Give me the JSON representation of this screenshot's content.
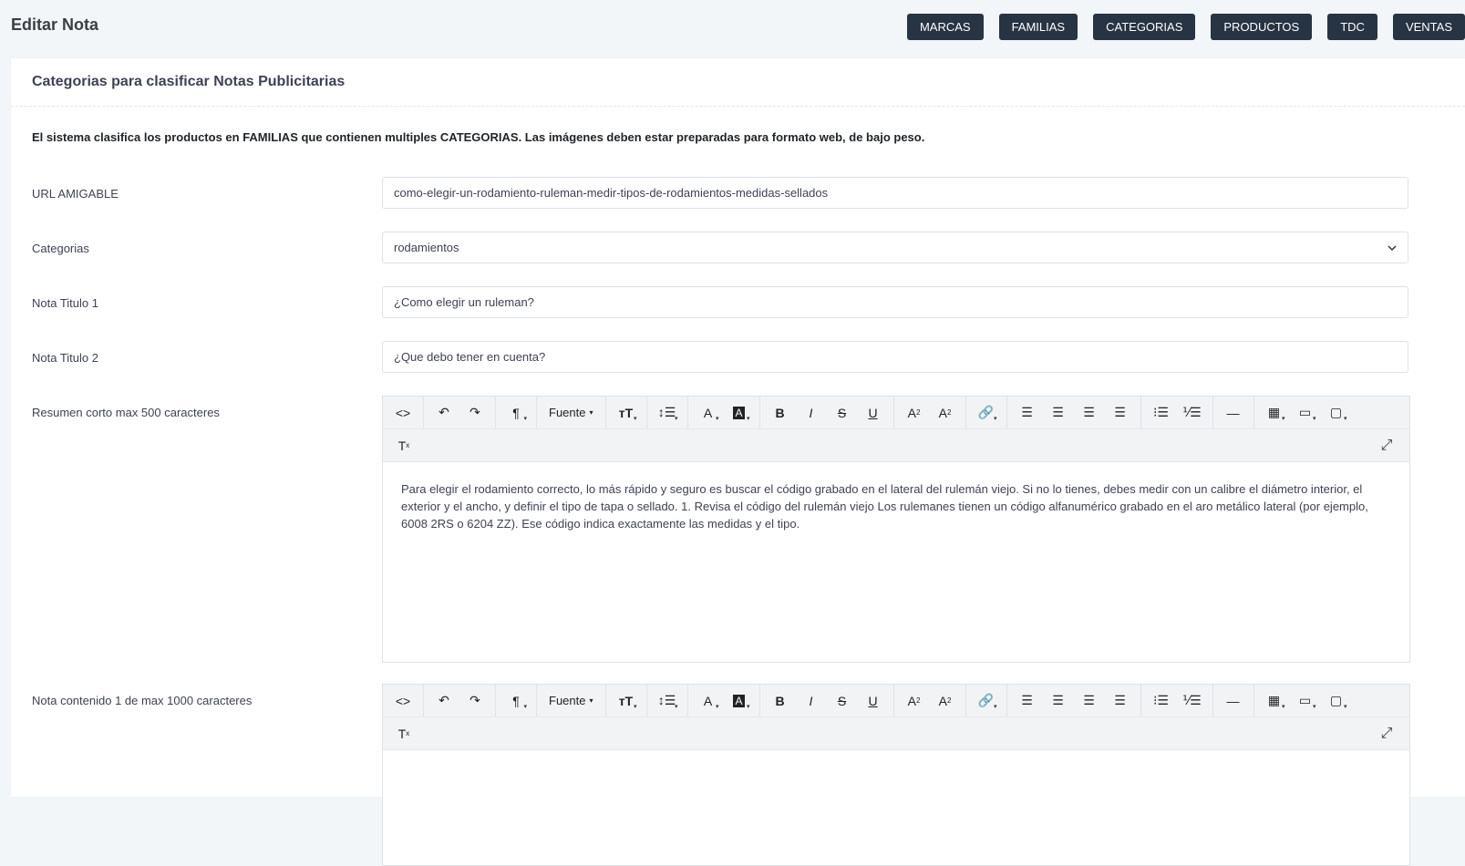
{
  "header": {
    "title": "Editar Nota"
  },
  "nav": [
    {
      "label": "MARCAS"
    },
    {
      "label": "FAMILIAS"
    },
    {
      "label": "CATEGORIAS"
    },
    {
      "label": "PRODUCTOS"
    },
    {
      "label": "TDC"
    },
    {
      "label": "VENTAS"
    }
  ],
  "card": {
    "title": "Categorias para clasificar Notas Publicitarias",
    "intro": "El sistema clasifica los productos en FAMILIAS que contienen multiples CATEGORIAS. Las imágenes deben estar preparadas para formato web, de bajo peso."
  },
  "form": {
    "url": {
      "label": "URL AMIGABLE",
      "value": "como-elegir-un-rodamiento-ruleman-medir-tipos-de-rodamientos-medidas-sellados"
    },
    "categoria": {
      "label": "Categorias",
      "value": "rodamientos"
    },
    "titulo1": {
      "label": "Nota Titulo 1",
      "value": "¿Como elegir un ruleman?"
    },
    "titulo2": {
      "label": "Nota Titulo 2",
      "value": "¿Que debo tener en cuenta?"
    },
    "resumen": {
      "label": "Resumen corto max 500 caracteres",
      "content": "Para elegir el rodamiento correcto, lo más rápido y seguro es buscar el código grabado en el lateral del rulemán viejo. Si no lo tienes, debes medir con un calibre el diámetro interior, el exterior y el ancho, y definir el tipo de tapa o sellado. 1. Revisa el código del rulemán viejo Los rulemanes tienen un código alfanumérico grabado en el aro metálico lateral (por ejemplo, 6008 2RS o 6204 ZZ). Ese código indica exactamente las medidas y el tipo."
    },
    "contenido1": {
      "label": "Nota contenido 1 de max 1000 caracteres",
      "content": ""
    }
  },
  "toolbar": {
    "font_label": "Fuente"
  },
  "colors": {
    "nav_bg": "#273444",
    "page_bg": "#f3f6f9"
  }
}
